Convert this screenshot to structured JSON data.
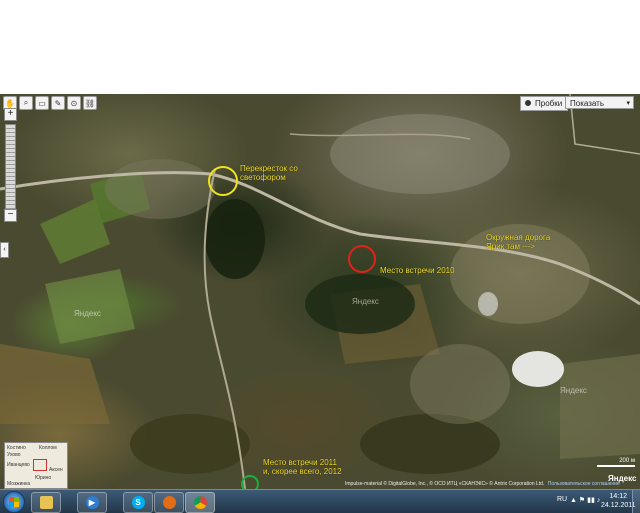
{
  "map_controls": {
    "toolbar_icons": [
      "hand-icon",
      "magnifier-icon",
      "ruler-icon",
      "pen-icon",
      "search-icon",
      "link-icon"
    ],
    "zoom_plus": "+",
    "zoom_minus": "−",
    "layer_traffic": "Пробки",
    "layer_select": "Показать",
    "chevron": "▾"
  },
  "annotations": {
    "crossroad_line1": "Перекресток со",
    "crossroad_line2": "светофором",
    "ringroad_line1": "Окружная дорога",
    "ringroad_line2": "Ярик там --->",
    "meet2010": "Место встречи 2010",
    "meet2011_line1": "Место встречи 2011",
    "meet2011_line2": "и, скорее всего,  2012"
  },
  "markers": {
    "yellow": "#f1e21b",
    "red": "#e0221c",
    "green": "#1fae3d"
  },
  "minimap": {
    "labels": [
      "Костино",
      "Коллом",
      "Ухово",
      "Иванцево",
      "Аксен",
      "Юрино",
      "Мозжинка"
    ]
  },
  "watermarks": [
    "Яндекс",
    "Яндекс",
    "Яндекс"
  ],
  "copyright": {
    "text": "Impulse-material © DigitalGlobe, Inc., © ОСО ИТЦ «СКАНЭКС» © Antrix Corporation Ltd.",
    "terms": "Пользовательское соглашение"
  },
  "scale": "200 м",
  "yandex_logo": "Яндекс",
  "taskbar": {
    "apps": [
      "explorer-icon",
      "media-player-icon",
      "skype-icon",
      "firefox-icon",
      "chrome-icon"
    ],
    "lang": "RU",
    "tray": "▲ ⚑ ▮▮ ♪",
    "time": "14:12",
    "date": "24.12.2011"
  }
}
